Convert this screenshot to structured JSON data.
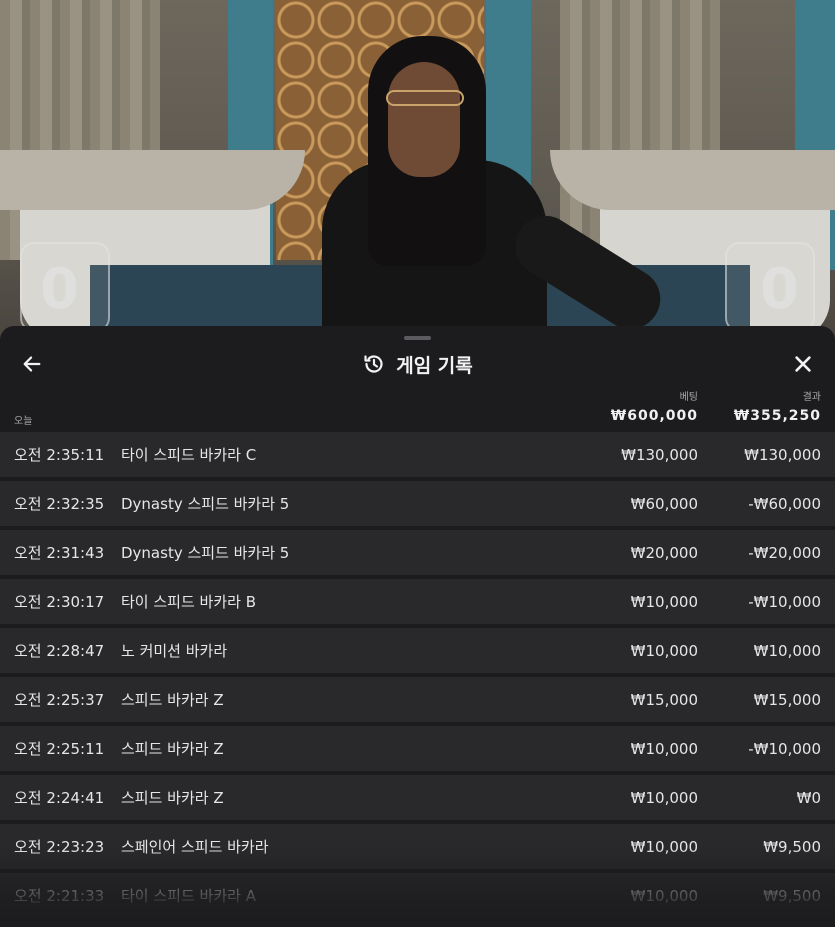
{
  "video": {
    "shoe_left_count": "0",
    "shoe_right_count": "0"
  },
  "sheet": {
    "title": "게임 기록",
    "icons": {
      "back": "arrow-left-icon",
      "history": "history-clock-icon",
      "close": "close-x-icon"
    },
    "columns": {
      "bet": "베팅",
      "result": "결과"
    },
    "day_label": "오늘",
    "totals": {
      "bet": "₩600,000",
      "result": "₩355,250"
    },
    "rows": [
      {
        "time": "오전 2:35:11",
        "game": "타이 스피드 바카라 C",
        "bet": "₩130,000",
        "result": "₩130,000"
      },
      {
        "time": "오전 2:32:35",
        "game": "Dynasty 스피드 바카라 5",
        "bet": "₩60,000",
        "result": "-₩60,000"
      },
      {
        "time": "오전 2:31:43",
        "game": "Dynasty 스피드 바카라 5",
        "bet": "₩20,000",
        "result": "-₩20,000"
      },
      {
        "time": "오전 2:30:17",
        "game": "타이 스피드 바카라 B",
        "bet": "₩10,000",
        "result": "-₩10,000"
      },
      {
        "time": "오전 2:28:47",
        "game": "노 커미션 바카라",
        "bet": "₩10,000",
        "result": "₩10,000"
      },
      {
        "time": "오전 2:25:37",
        "game": "스피드 바카라 Z",
        "bet": "₩15,000",
        "result": "₩15,000"
      },
      {
        "time": "오전 2:25:11",
        "game": "스피드 바카라 Z",
        "bet": "₩10,000",
        "result": "-₩10,000"
      },
      {
        "time": "오전 2:24:41",
        "game": "스피드 바카라 Z",
        "bet": "₩10,000",
        "result": "₩0"
      },
      {
        "time": "오전 2:23:23",
        "game": "스페인어 스피드 바카라",
        "bet": "₩10,000",
        "result": "₩9,500"
      },
      {
        "time": "오전 2:21:33",
        "game": "타이 스피드 바카라 A",
        "bet": "₩10,000",
        "result": "₩9,500"
      }
    ]
  },
  "colors": {
    "sheet_bg": "#1c1c1e",
    "row_bg": "#29292c",
    "text": "#e6e6e7",
    "muted": "#a9a9ad"
  }
}
